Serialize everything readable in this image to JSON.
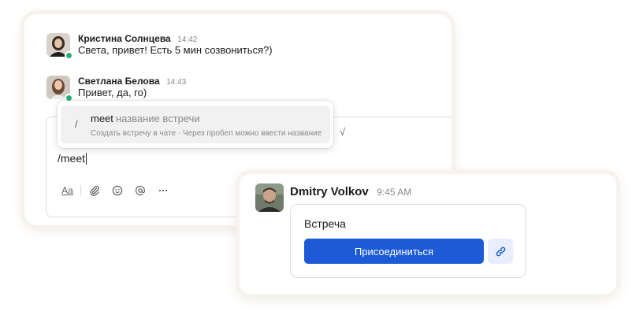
{
  "messages": [
    {
      "author": "Кристина Солнцева",
      "time": "14:42",
      "text": "Света, привет! Есть 5 мин созвониться?)"
    },
    {
      "author": "Светлана Белова",
      "time": "14:43",
      "text": "Привет, да, го)"
    }
  ],
  "composer": {
    "value": "/meet",
    "toolbar_text_label": "Aa"
  },
  "slash_menu": {
    "symbol": "/",
    "command": "meet",
    "argument_hint": "название встречи",
    "description": "Создать встречу в чате · Через пробел можно ввести название"
  },
  "meeting_message": {
    "author": "Dmitry Volkov",
    "time": "9:45 AM",
    "title": "Встреча",
    "join_label": "Присоединиться"
  },
  "colors": {
    "presence": "#2bac76",
    "join_button": "#1d5bd6",
    "link_button_bg": "#e8eefc"
  },
  "icons": [
    "text-format-icon",
    "attachment-icon",
    "emoji-icon",
    "mention-icon",
    "more-icon",
    "sqrt-icon",
    "link-icon"
  ]
}
